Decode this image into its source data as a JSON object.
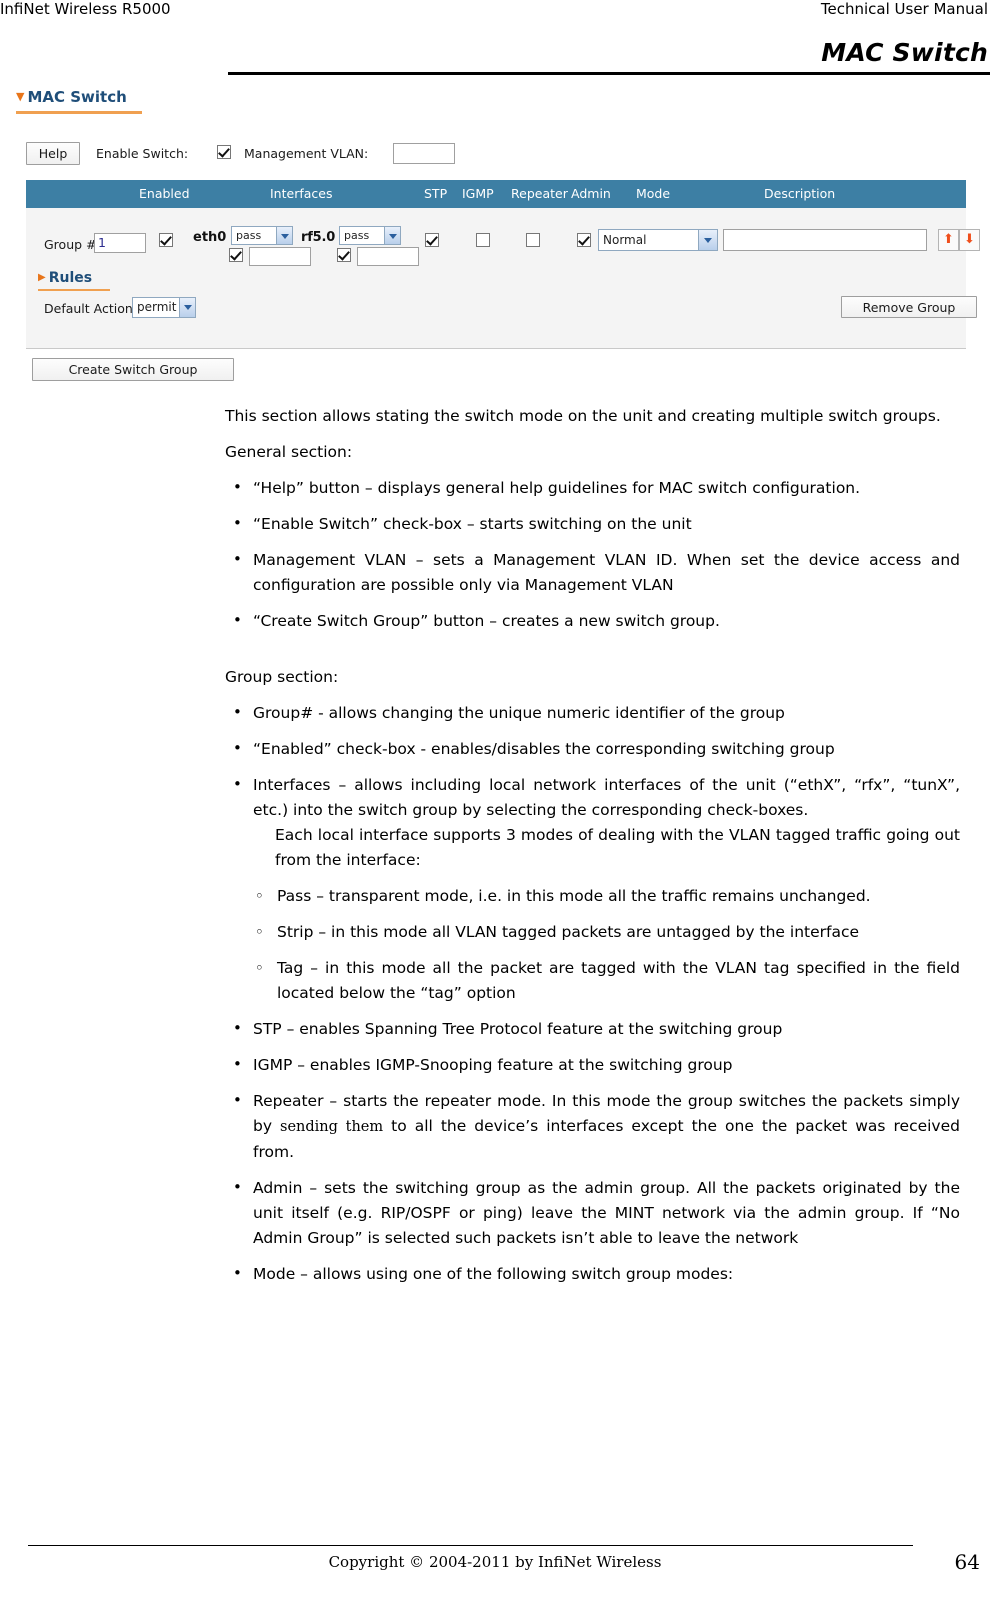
{
  "header": {
    "left": "InfiNet Wireless R5000",
    "right": "Technical User Manual"
  },
  "doc_title": "MAC Switch",
  "ui": {
    "panel_title": "MAC Switch",
    "caret": "▼",
    "general": {
      "help_button": "Help",
      "enable_switch_label": "Enable Switch:",
      "enable_switch_checked": true,
      "management_vlan_label": "Management VLAN:",
      "management_vlan_value": ""
    },
    "table_headers": {
      "enabled": "Enabled",
      "interfaces": "Interfaces",
      "stp": "STP",
      "igmp": "IGMP",
      "repeater": "Repeater",
      "admin": "Admin",
      "mode": "Mode",
      "description": "Description"
    },
    "group": {
      "group_label": "Group #",
      "group_number": "1",
      "enabled_checked": true,
      "interfaces": [
        {
          "name": "eth0",
          "mode": "pass",
          "checked": true,
          "tag_value": ""
        },
        {
          "name": "rf5.0",
          "mode": "pass",
          "checked": true,
          "tag_value": ""
        }
      ],
      "stp_checked": true,
      "igmp_checked": false,
      "repeater_checked": false,
      "admin_checked": true,
      "mode_value": "Normal",
      "description_value": "",
      "move_up_icon": "⬆",
      "move_down_icon": "⬇"
    },
    "rules": {
      "title": "Rules",
      "caret": "▶",
      "default_action_label": "Default Action:",
      "default_action_value": "permit"
    },
    "remove_group_button": "Remove Group",
    "create_switch_group_button": "Create Switch Group"
  },
  "content": {
    "intro": "This section allows stating the switch mode on the unit and creating multiple switch groups.",
    "general_heading": "General section:",
    "general_bullets": [
      "“Help” button – displays general help guidelines for MAC switch configuration.",
      "“Enable Switch” check-box – starts switching on the unit",
      "Management VLAN – sets a Management VLAN ID. When set the device access and configuration are possible only via Management VLAN",
      "“Create Switch Group” button – creates a new switch group."
    ],
    "group_heading": "Group section:",
    "group_bullet_1": "Group# - allows changing the unique numeric identifier of the group",
    "group_bullet_2": "“Enabled”  check-box   -  enables/disables  the  corresponding  switching group",
    "group_bullet_3": "Interfaces – allows including local network interfaces of the unit (“ethX”, “rfx”, “tunX”, etc.) into the switch group by selecting the corresponding check-boxes.",
    "interfaces_note": "Each local interface supports 3 modes of dealing with the VLAN tagged traffic going out from the interface:",
    "interface_modes": [
      "Pass – transparent mode, i.e. in this mode all the traffic remains unchanged.",
      "Strip – in this mode all VLAN tagged packets are untagged by the interface",
      "Tag – in this mode all the packet are tagged with the VLAN tag specified in the field located below the “tag” option"
    ],
    "group_bullet_stp": "STP – enables Spanning Tree Protocol feature at the switching group",
    "group_bullet_igmp": "IGMP – enables IGMP-Snooping feature at the switching group",
    "group_bullet_repeater_a": "Repeater – starts the repeater mode. In this mode the group switches the packets simply by ",
    "group_bullet_repeater_mono": "sending them",
    "group_bullet_repeater_b": " to all the device’s interfaces except the one the packet was received from.",
    "group_bullet_admin": "Admin – sets the switching group as the admin group. All the packets originated by the unit itself (e.g. RIP/OSPF or ping) leave the MINT network via the admin group. If “No Admin Group” is selected such packets isn’t able to leave the network",
    "group_bullet_mode": "Mode – allows using one of the following switch group modes:"
  },
  "footer": {
    "copyright": "Copyright © 2004-2011 by InfiNet Wireless",
    "page_number": "64"
  },
  "colors": {
    "table_header_blue": "#3d7fa4",
    "panel_title_blue": "#1f4e79",
    "accent_orange": "#f0a050",
    "arrow_orange": "#ef4f1c"
  }
}
